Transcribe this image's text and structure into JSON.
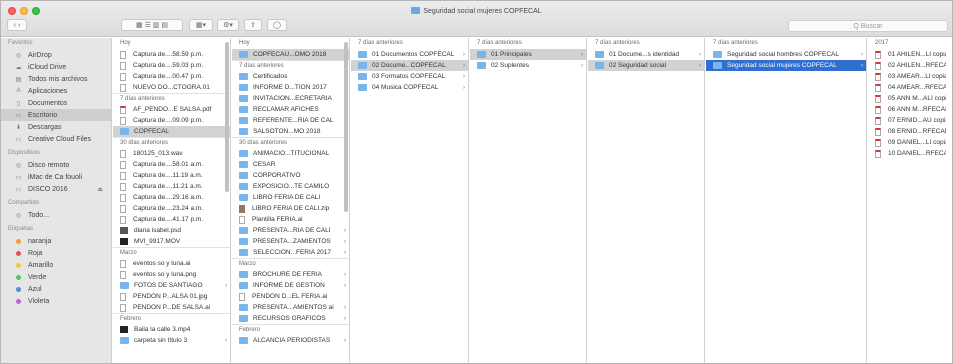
{
  "window": {
    "title": "Seguridad social mujeres COPFECAL",
    "accent": "#2f6fd1",
    "frame_color": "#c83a5c"
  },
  "toolbar": {
    "nav_label": "‹ ›",
    "view_icons": "▦ ☰ ▥ ▤",
    "group_label": "▦▾",
    "action_label": "⚙▾",
    "share_label": "⇧",
    "tag_label": "◯",
    "search_placeholder": "Q Buscar"
  },
  "sidebar": {
    "favorites_header": "Favoritos",
    "favorites": [
      {
        "icon": "airdrop-icon",
        "glyph": "◎",
        "label": "AirDrop"
      },
      {
        "icon": "cloud-icon",
        "glyph": "☁",
        "label": "iCloud Drive"
      },
      {
        "icon": "all-files-icon",
        "glyph": "▤",
        "label": "Todos mis archivos"
      },
      {
        "icon": "applications-icon",
        "glyph": "A",
        "label": "Aplicaciones"
      },
      {
        "icon": "documents-icon",
        "glyph": "▯",
        "label": "Documentos"
      },
      {
        "icon": "desktop-icon",
        "glyph": "▭",
        "label": "Escritorio"
      },
      {
        "icon": "downloads-icon",
        "glyph": "⬇",
        "label": "Descargas"
      },
      {
        "icon": "folder-icon",
        "glyph": "▭",
        "label": "Creative Cloud Files"
      }
    ],
    "devices_header": "Dispositivos",
    "devices": [
      {
        "icon": "disc-icon",
        "glyph": "◎",
        "label": "Disco remoto"
      },
      {
        "icon": "computer-icon",
        "glyph": "▭",
        "label": "iMac de Ca fouoli"
      },
      {
        "icon": "drive-icon",
        "glyph": "▭",
        "label": "DISCO 2016",
        "eject": "⏏"
      }
    ],
    "shared_header": "Compartido",
    "shared": [
      {
        "icon": "network-icon",
        "glyph": "◎",
        "label": "Todo..."
      }
    ],
    "tags_header": "Etiquetas",
    "tags": [
      {
        "label": "naranja",
        "color": "#f39a3a"
      },
      {
        "label": "Roja",
        "color": "#e8514f"
      },
      {
        "label": "Amarillo",
        "color": "#f2c83a"
      },
      {
        "label": "Verde",
        "color": "#5cc55a"
      },
      {
        "label": "Azul",
        "color": "#4a90e2"
      },
      {
        "label": "Violeta",
        "color": "#b56ad6"
      }
    ]
  },
  "col1": {
    "sections": [
      {
        "header": "Hoy",
        "items": [
          {
            "type": "doc",
            "label": "Captura de....58.59 p.m.",
            "arrow": ""
          },
          {
            "type": "doc",
            "label": "Captura de....59.03 p.m.",
            "arrow": ""
          },
          {
            "type": "doc",
            "label": "Captura de....00.47 p.m.",
            "arrow": ""
          },
          {
            "type": "doc",
            "label": "NUEVO DO...CTOGRA.01",
            "arrow": ""
          }
        ]
      },
      {
        "header": "7 días anteriores",
        "items": [
          {
            "type": "pdf",
            "label": "AF_PENDO...E SALSA.pdf",
            "arrow": ""
          },
          {
            "type": "doc",
            "label": "Captura de....09.09 p.m.",
            "arrow": ""
          },
          {
            "type": "folder",
            "label": "COPFECAL",
            "arrow": "›",
            "state": "sel"
          }
        ]
      },
      {
        "header": "30 días anteriores",
        "items": [
          {
            "type": "doc",
            "label": "180125_013.wav",
            "arrow": ""
          },
          {
            "type": "doc",
            "label": "Captura de....58.01 a.m.",
            "arrow": ""
          },
          {
            "type": "doc",
            "label": "Captura de....11.19 a.m.",
            "arrow": ""
          },
          {
            "type": "doc",
            "label": "Captura de....11.21 a.m.",
            "arrow": ""
          },
          {
            "type": "doc",
            "label": "Captura de....29.16 a.m.",
            "arrow": ""
          },
          {
            "type": "doc",
            "label": "Captura de....23.24 a.m.",
            "arrow": ""
          },
          {
            "type": "doc",
            "label": "Captura de....41.17 p.m.",
            "arrow": ""
          },
          {
            "type": "img",
            "label": "diana isabel.psd",
            "arrow": ""
          },
          {
            "type": "vid",
            "label": "MVI_9917.MOV",
            "arrow": ""
          }
        ]
      },
      {
        "header": "Marzo",
        "items": [
          {
            "type": "doc",
            "label": "eventos so y luna.ai",
            "arrow": ""
          },
          {
            "type": "doc",
            "label": "eventos so y luna.png",
            "arrow": ""
          },
          {
            "type": "folder",
            "label": "FOTOS DE SANTIAGO",
            "arrow": "›"
          },
          {
            "type": "doc",
            "label": "PENDON P...ALSA 01.jpg",
            "arrow": ""
          },
          {
            "type": "doc",
            "label": "PENDON P...DE SALSA.ai",
            "arrow": ""
          }
        ]
      },
      {
        "header": "Febrero",
        "items": [
          {
            "type": "vid",
            "label": "Baila la calle 3.mp4",
            "arrow": ""
          },
          {
            "type": "folder",
            "label": "carpeta sin título 3",
            "arrow": "›"
          }
        ]
      }
    ]
  },
  "col2": {
    "sections": [
      {
        "header": "Hoy",
        "items": [
          {
            "type": "folder",
            "label": "COPFECAU...OMO 2018",
            "arrow": "›",
            "state": "sel"
          }
        ]
      },
      {
        "header": "7 días anteriores",
        "items": [
          {
            "type": "folder",
            "label": "Certificados",
            "arrow": "›"
          },
          {
            "type": "folder",
            "label": "INFORME D...TIÓN 2017",
            "arrow": "›"
          },
          {
            "type": "folder",
            "label": "INVITACION...ECRETARIA",
            "arrow": "›"
          },
          {
            "type": "folder",
            "label": "RECLAMAR AFICHES",
            "arrow": "›"
          },
          {
            "type": "folder",
            "label": "REFERENTE...RIA DE CAL",
            "arrow": "›"
          },
          {
            "type": "folder",
            "label": "SALSOTON...MO 2018",
            "arrow": "›"
          }
        ]
      },
      {
        "header": "30 días anteriores",
        "items": [
          {
            "type": "folder",
            "label": "ANIMACIÓ...TITUCIONAL",
            "arrow": "›"
          },
          {
            "type": "folder",
            "label": "CESAR",
            "arrow": "›"
          },
          {
            "type": "folder",
            "label": "CORPORATIVO",
            "arrow": "›"
          },
          {
            "type": "folder",
            "label": "EXPOSICIÓ...TE CAMILO",
            "arrow": "›"
          },
          {
            "type": "folder",
            "label": "LIBRO FERIA DE CALI",
            "arrow": "›"
          },
          {
            "type": "zip",
            "label": "LIBRO FERIA DE CALI.zip",
            "arrow": ""
          },
          {
            "type": "doc",
            "label": "Plantilla FERIA.ai",
            "arrow": ""
          },
          {
            "type": "folder",
            "label": "PRESENTA...RIA DE CALI",
            "arrow": "›"
          },
          {
            "type": "folder",
            "label": "PRESENTA...ZAMIENTOS",
            "arrow": "›"
          },
          {
            "type": "folder",
            "label": "SELECCION...FERIA 2017",
            "arrow": "›"
          }
        ]
      },
      {
        "header": "Marzo",
        "items": [
          {
            "type": "folder",
            "label": "BROCHURE DE FERIA",
            "arrow": "›"
          },
          {
            "type": "folder",
            "label": "INFORME DE GESTION",
            "arrow": "›"
          },
          {
            "type": "doc",
            "label": "PENDON D...EL FERIA.ai",
            "arrow": ""
          },
          {
            "type": "folder",
            "label": "PRESENTA...AMIENTOS ai",
            "arrow": "›"
          },
          {
            "type": "folder",
            "label": "RECURSOS GRÁFICOS",
            "arrow": "›"
          }
        ]
      },
      {
        "header": "Febrero",
        "items": [
          {
            "type": "folder",
            "label": "ALCANCIA PERIODISTAS",
            "arrow": "›"
          }
        ]
      }
    ]
  },
  "col3": {
    "sections": [
      {
        "header": "7 días anteriores",
        "items": [
          {
            "type": "folder",
            "label": "01 Documentos COPFECAL",
            "arrow": "›"
          },
          {
            "type": "folder",
            "label": "02 Docume...COPFECAL",
            "arrow": "›",
            "state": "sel"
          },
          {
            "type": "folder",
            "label": "03 Formatos COPFECAL",
            "arrow": "›"
          },
          {
            "type": "folder",
            "label": "04 Musica COPFECAL",
            "arrow": "›"
          }
        ]
      }
    ]
  },
  "col4": {
    "sections": [
      {
        "header": "7 días anteriores",
        "items": [
          {
            "type": "folder",
            "label": "01 Principales",
            "arrow": "›",
            "state": "sel"
          },
          {
            "type": "folder",
            "label": "02 Suplentes",
            "arrow": "›"
          }
        ]
      }
    ]
  },
  "col5": {
    "sections": [
      {
        "header": "7 días anteriores",
        "items": [
          {
            "type": "folder",
            "label": "01 Docume...s identidad",
            "arrow": "›"
          },
          {
            "type": "folder",
            "label": "02 Seguridad social",
            "arrow": "›",
            "state": "sel"
          }
        ]
      }
    ]
  },
  "col6": {
    "sections": [
      {
        "header": "7 días anteriores",
        "items": [
          {
            "type": "folder",
            "label": "Seguridad social hombres COPFECAL",
            "arrow": "›"
          },
          {
            "type": "folder",
            "label": "Seguridad social mujeres COPFECAL",
            "arrow": "›",
            "state": "selblue"
          }
        ]
      }
    ]
  },
  "col7": {
    "sections": [
      {
        "header": "2017",
        "items": [
          {
            "type": "pdf",
            "label": "01 AHILEN...LI copia.pdf",
            "arrow": ""
          },
          {
            "type": "pdf",
            "label": "02 AHILEN...RFECAL.pdf",
            "arrow": ""
          },
          {
            "type": "pdf",
            "label": "03 AMEAR...Ll copia.pdf",
            "arrow": ""
          },
          {
            "type": "pdf",
            "label": "04 AMEAR...RFECAL.pdf",
            "arrow": ""
          },
          {
            "type": "pdf",
            "label": "05 ANN M...ALI copia.pdf",
            "arrow": ""
          },
          {
            "type": "pdf",
            "label": "06 ANN M...RFECAL.pdf",
            "arrow": ""
          },
          {
            "type": "pdf",
            "label": "07 ERNID...AU copia.pdf",
            "arrow": ""
          },
          {
            "type": "pdf",
            "label": "08 ERNID...RFECAL.pdf",
            "arrow": ""
          },
          {
            "type": "pdf",
            "label": "09 DANIEL...LI copia.pdf",
            "arrow": ""
          },
          {
            "type": "pdf",
            "label": "10 DANIEL...RFECAL.pdf",
            "arrow": ""
          }
        ]
      }
    ]
  }
}
